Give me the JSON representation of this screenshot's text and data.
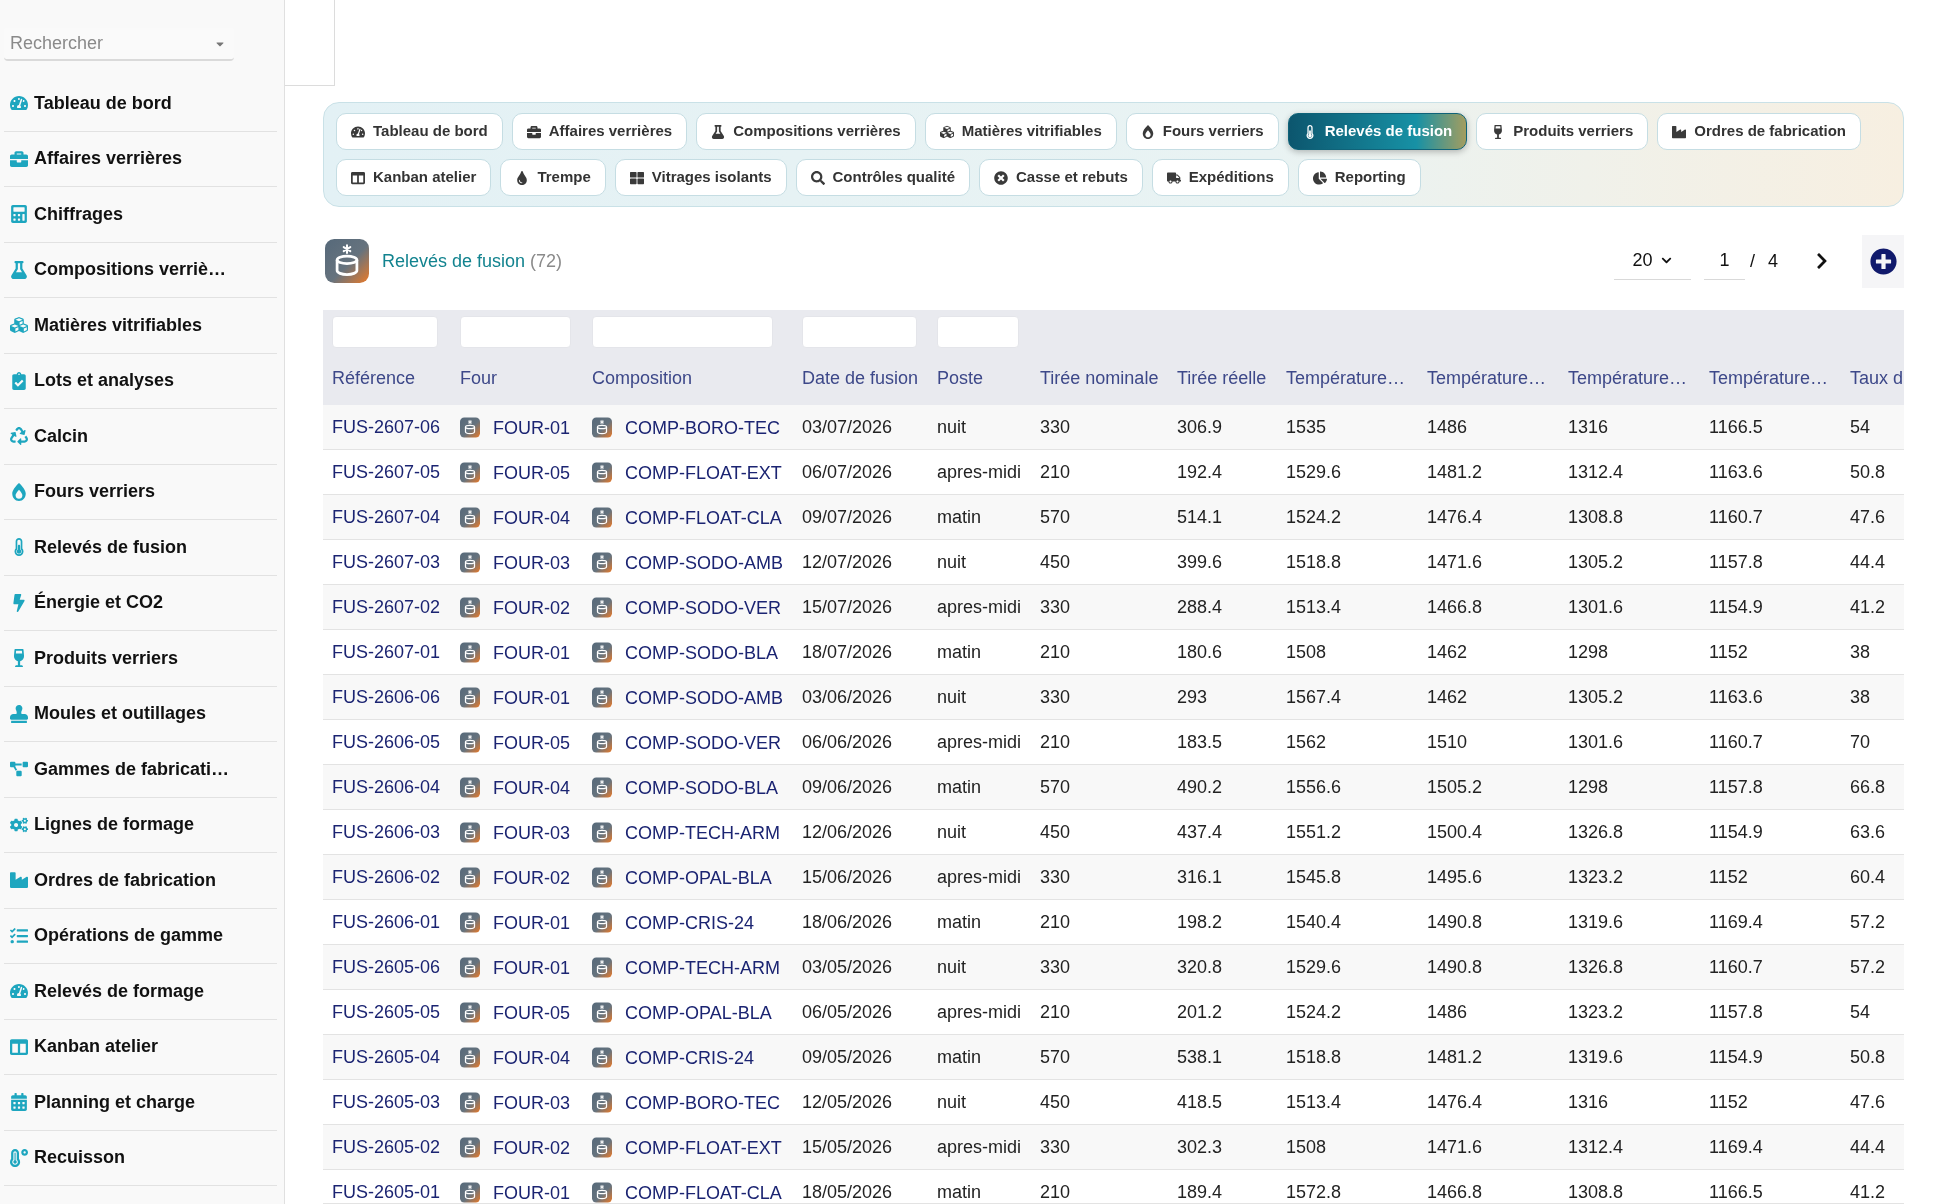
{
  "sidebar": {
    "search": {
      "placeholder": "Rechercher"
    },
    "items": [
      {
        "label": "Tableau de bord"
      },
      {
        "label": "Affaires verrières"
      },
      {
        "label": "Chiffrages"
      },
      {
        "label": "Compositions verriè…"
      },
      {
        "label": "Matières vitrifiables"
      },
      {
        "label": "Lots et analyses"
      },
      {
        "label": "Calcin"
      },
      {
        "label": "Fours verriers"
      },
      {
        "label": "Relevés de fusion"
      },
      {
        "label": "Énergie et CO2"
      },
      {
        "label": "Produits verriers"
      },
      {
        "label": "Moules et outillages"
      },
      {
        "label": "Gammes de fabricati…"
      },
      {
        "label": "Lignes de formage"
      },
      {
        "label": "Ordres de fabrication"
      },
      {
        "label": "Opérations de gamme"
      },
      {
        "label": "Relevés de formage"
      },
      {
        "label": "Kanban atelier"
      },
      {
        "label": "Planning et charge"
      },
      {
        "label": "Recuisson"
      }
    ]
  },
  "tabs": [
    {
      "label": "Tableau de bord",
      "selected": false
    },
    {
      "label": "Affaires verrières",
      "selected": false
    },
    {
      "label": "Compositions verrières",
      "selected": false
    },
    {
      "label": "Matières vitrifiables",
      "selected": false
    },
    {
      "label": "Fours verriers",
      "selected": false
    },
    {
      "label": "Relevés de fusion",
      "selected": true
    },
    {
      "label": "Produits verriers",
      "selected": false
    },
    {
      "label": "Ordres de fabrication",
      "selected": false
    },
    {
      "label": "Kanban atelier",
      "selected": false
    },
    {
      "label": "Trempe",
      "selected": false
    },
    {
      "label": "Vitrages isolants",
      "selected": false
    },
    {
      "label": "Contrôles qualité",
      "selected": false
    },
    {
      "label": "Casse et rebuts",
      "selected": false
    },
    {
      "label": "Expéditions",
      "selected": false
    },
    {
      "label": "Reporting",
      "selected": false
    }
  ],
  "page_header": {
    "title": "Relevés de fusion",
    "count": "(72)",
    "pagination": {
      "page_size": "20",
      "page": "1",
      "separator": "/",
      "page_count": "4"
    }
  },
  "table": {
    "columns": [
      {
        "label": "Référence",
        "kind": "link",
        "filter": true
      },
      {
        "label": "Four",
        "kind": "icon_link",
        "filter": true
      },
      {
        "label": "Composition",
        "kind": "icon_link",
        "filter": true
      },
      {
        "label": "Date de fusion",
        "kind": "text",
        "filter": true
      },
      {
        "label": "Poste",
        "kind": "text",
        "filter": true
      },
      {
        "label": "Tirée nominale",
        "kind": "text",
        "filter": false
      },
      {
        "label": "Tirée réelle",
        "kind": "text",
        "filter": false
      },
      {
        "label": "Température…",
        "kind": "text",
        "filter": false
      },
      {
        "label": "Température…",
        "kind": "text",
        "filter": false
      },
      {
        "label": "Température…",
        "kind": "text",
        "filter": false
      },
      {
        "label": "Température…",
        "kind": "text",
        "filter": false
      },
      {
        "label": "Taux d",
        "kind": "text",
        "filter": false
      }
    ],
    "rows": [
      {
        "cells": [
          "FUS-2607-06",
          "FOUR-01",
          "COMP-BORO-TEC",
          "03/07/2026",
          "nuit",
          "330",
          "306.9",
          "1535",
          "1486",
          "1316",
          "1166.5",
          "54"
        ]
      },
      {
        "cells": [
          "FUS-2607-05",
          "FOUR-05",
          "COMP-FLOAT-EXT",
          "06/07/2026",
          "apres-midi",
          "210",
          "192.4",
          "1529.6",
          "1481.2",
          "1312.4",
          "1163.6",
          "50.8"
        ]
      },
      {
        "cells": [
          "FUS-2607-04",
          "FOUR-04",
          "COMP-FLOAT-CLA",
          "09/07/2026",
          "matin",
          "570",
          "514.1",
          "1524.2",
          "1476.4",
          "1308.8",
          "1160.7",
          "47.6"
        ]
      },
      {
        "cells": [
          "FUS-2607-03",
          "FOUR-03",
          "COMP-SODO-AMB",
          "12/07/2026",
          "nuit",
          "450",
          "399.6",
          "1518.8",
          "1471.6",
          "1305.2",
          "1157.8",
          "44.4"
        ]
      },
      {
        "cells": [
          "FUS-2607-02",
          "FOUR-02",
          "COMP-SODO-VER",
          "15/07/2026",
          "apres-midi",
          "330",
          "288.4",
          "1513.4",
          "1466.8",
          "1301.6",
          "1154.9",
          "41.2"
        ]
      },
      {
        "cells": [
          "FUS-2607-01",
          "FOUR-01",
          "COMP-SODO-BLA",
          "18/07/2026",
          "matin",
          "210",
          "180.6",
          "1508",
          "1462",
          "1298",
          "1152",
          "38"
        ]
      },
      {
        "cells": [
          "FUS-2606-06",
          "FOUR-01",
          "COMP-SODO-AMB",
          "03/06/2026",
          "nuit",
          "330",
          "293",
          "1567.4",
          "1462",
          "1305.2",
          "1163.6",
          "38"
        ]
      },
      {
        "cells": [
          "FUS-2606-05",
          "FOUR-05",
          "COMP-SODO-VER",
          "06/06/2026",
          "apres-midi",
          "210",
          "183.5",
          "1562",
          "1510",
          "1301.6",
          "1160.7",
          "70"
        ]
      },
      {
        "cells": [
          "FUS-2606-04",
          "FOUR-04",
          "COMP-SODO-BLA",
          "09/06/2026",
          "matin",
          "570",
          "490.2",
          "1556.6",
          "1505.2",
          "1298",
          "1157.8",
          "66.8"
        ]
      },
      {
        "cells": [
          "FUS-2606-03",
          "FOUR-03",
          "COMP-TECH-ARM",
          "12/06/2026",
          "nuit",
          "450",
          "437.4",
          "1551.2",
          "1500.4",
          "1326.8",
          "1154.9",
          "63.6"
        ]
      },
      {
        "cells": [
          "FUS-2606-02",
          "FOUR-02",
          "COMP-OPAL-BLA",
          "15/06/2026",
          "apres-midi",
          "330",
          "316.1",
          "1545.8",
          "1495.6",
          "1323.2",
          "1152",
          "60.4"
        ]
      },
      {
        "cells": [
          "FUS-2606-01",
          "FOUR-01",
          "COMP-CRIS-24",
          "18/06/2026",
          "matin",
          "210",
          "198.2",
          "1540.4",
          "1490.8",
          "1319.6",
          "1169.4",
          "57.2"
        ]
      },
      {
        "cells": [
          "FUS-2605-06",
          "FOUR-01",
          "COMP-TECH-ARM",
          "03/05/2026",
          "nuit",
          "330",
          "320.8",
          "1529.6",
          "1490.8",
          "1326.8",
          "1160.7",
          "57.2"
        ]
      },
      {
        "cells": [
          "FUS-2605-05",
          "FOUR-05",
          "COMP-OPAL-BLA",
          "06/05/2026",
          "apres-midi",
          "210",
          "201.2",
          "1524.2",
          "1486",
          "1323.2",
          "1157.8",
          "54"
        ]
      },
      {
        "cells": [
          "FUS-2605-04",
          "FOUR-04",
          "COMP-CRIS-24",
          "09/05/2026",
          "matin",
          "570",
          "538.1",
          "1518.8",
          "1481.2",
          "1319.6",
          "1154.9",
          "50.8"
        ]
      },
      {
        "cells": [
          "FUS-2605-03",
          "FOUR-03",
          "COMP-BORO-TEC",
          "12/05/2026",
          "nuit",
          "450",
          "418.5",
          "1513.4",
          "1476.4",
          "1316",
          "1152",
          "47.6"
        ]
      },
      {
        "cells": [
          "FUS-2605-02",
          "FOUR-02",
          "COMP-FLOAT-EXT",
          "15/05/2026",
          "apres-midi",
          "330",
          "302.3",
          "1508",
          "1471.6",
          "1312.4",
          "1169.4",
          "44.4"
        ]
      },
      {
        "cells": [
          "FUS-2605-01",
          "FOUR-01",
          "COMP-FLOAT-CLA",
          "18/05/2026",
          "matin",
          "210",
          "189.4",
          "1572.8",
          "1466.8",
          "1308.8",
          "1166.5",
          "41.2"
        ]
      }
    ]
  }
}
